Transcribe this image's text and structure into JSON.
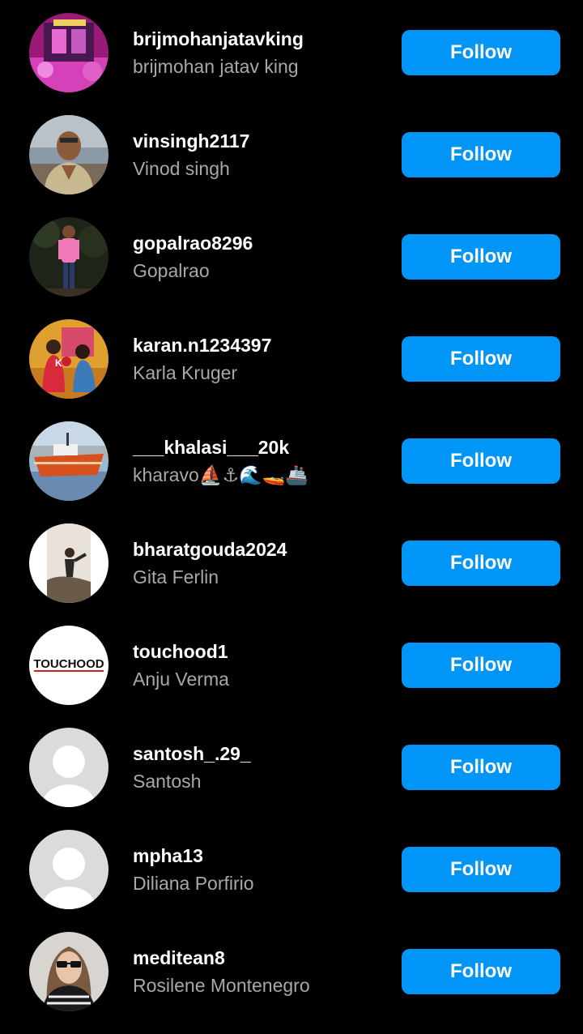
{
  "accent_color": "#0095f6",
  "suggestions": [
    {
      "username": "brijmohanjatavking",
      "full_name": "brijmohan jatav king",
      "button_label": "Follow",
      "avatar": "stage-photo"
    },
    {
      "username": "vinsingh2117",
      "full_name": "Vinod singh",
      "button_label": "Follow",
      "avatar": "man-portrait-photo"
    },
    {
      "username": "gopalrao8296",
      "full_name": "Gopalrao",
      "button_label": "Follow",
      "avatar": "man-standing-photo"
    },
    {
      "username": "karan.n1234397",
      "full_name": "Karla Kruger",
      "button_label": "Follow",
      "avatar": "couple-photo"
    },
    {
      "username": "___khalasi___20k",
      "full_name": "kharavo⛵⚓🌊🚤🚢",
      "button_label": "Follow",
      "avatar": "boat-photo"
    },
    {
      "username": "bharatgouda2024",
      "full_name": "Gita Ferlin",
      "button_label": "Follow",
      "avatar": "person-on-rock-photo"
    },
    {
      "username": "touchood1",
      "full_name": "Anju Verma",
      "button_label": "Follow",
      "avatar": "touchood-logo",
      "avatar_text": "TOUCHOOD"
    },
    {
      "username": "santosh_.29_",
      "full_name": "Santosh",
      "button_label": "Follow",
      "avatar": "default-avatar-icon"
    },
    {
      "username": "mpha13",
      "full_name": "Diliana Porfirio",
      "button_label": "Follow",
      "avatar": "default-avatar-icon"
    },
    {
      "username": "meditean8",
      "full_name": "Rosilene Montenegro",
      "button_label": "Follow",
      "avatar": "woman-sunglasses-photo"
    }
  ]
}
